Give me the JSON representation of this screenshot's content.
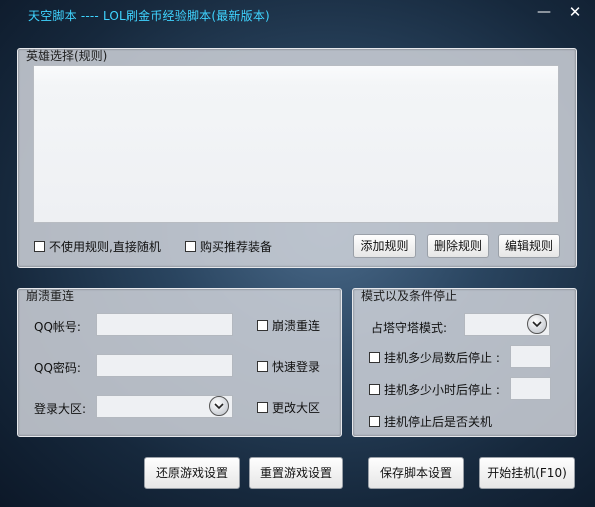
{
  "window": {
    "title": "天空脚本 ---- LOL刷金币经验脚本(最新版本)",
    "minimize_glyph": "—",
    "close_glyph": "✕"
  },
  "hero_panel": {
    "title": "英雄选择(规则)",
    "checkbox_random": "不使用规则,直接随机",
    "checkbox_buy": "购买推荐装备",
    "add_rule": "添加规则",
    "delete_rule": "删除规则",
    "edit_rule": "编辑规则"
  },
  "crash_panel": {
    "title": "崩溃重连",
    "qq_account_label": "QQ帐号:",
    "qq_account_value": "",
    "qq_password_label": "QQ密码:",
    "qq_password_value": "",
    "region_label": "登录大区:",
    "region_value": "",
    "cb_crash_reconnect": "崩溃重连",
    "cb_quick_login": "快速登录",
    "cb_change_region": "更改大区"
  },
  "mode_panel": {
    "title": "模式以及条件停止",
    "tower_mode_label": "占塔守塔模式:",
    "tower_mode_value": "",
    "cb_stop_after_games": "挂机多少局数后停止 :",
    "games_value": "",
    "cb_stop_after_hours": "挂机多少小时后停止 :",
    "hours_value": "",
    "cb_shutdown": "挂机停止后是否关机"
  },
  "footer": {
    "restore_game": "还原游戏设置",
    "reset_game": "重置游戏设置",
    "save_script": "保存脚本设置",
    "start": "开始挂机(F10)"
  },
  "colors": {
    "title_text": "#3fd4ff"
  },
  "icons": [
    "minimize-icon",
    "close-icon",
    "chevron-down-icon",
    "checkbox-icon"
  ]
}
